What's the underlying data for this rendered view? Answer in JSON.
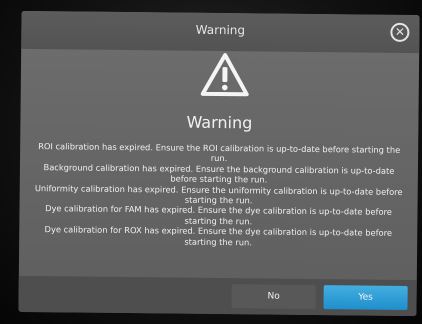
{
  "dialog": {
    "title": "Warning",
    "heading": "Warning",
    "close_icon": "close-circle-icon",
    "warning_icon": "warning-triangle-icon",
    "messages": [
      "ROI calibration has expired. Ensure the ROI calibration is up-to-date before starting the run.",
      "Background calibration has expired. Ensure the background calibration is up-to-date before starting the run.",
      "Uniformity calibration has expired. Ensure the uniformity calibration is up-to-date before starting the run.",
      "Dye calibration for FAM has expired. Ensure the dye calibration is up-to-date before starting the run.",
      "Dye calibration for ROX has expired. Ensure the dye calibration is up-to-date before starting the run."
    ],
    "buttons": {
      "no_label": "No",
      "yes_label": "Yes"
    },
    "colors": {
      "accent": "#2a9ad6",
      "background": "#676767"
    }
  }
}
